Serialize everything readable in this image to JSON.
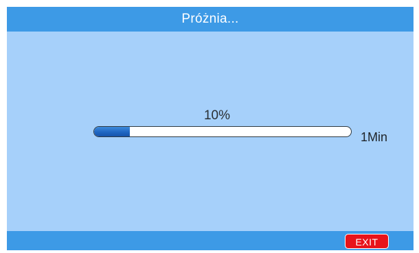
{
  "header": {
    "title": "Próżnia..."
  },
  "progress": {
    "percent_label": "10%",
    "fraction": 0.14,
    "time_label": "1Min"
  },
  "footer": {
    "exit_label": "EXIT"
  },
  "colors": {
    "background": "#a6d0fa",
    "bars": "#3d9ae6",
    "progress_fill": "#1f66c2",
    "exit_button": "#e8141b"
  }
}
